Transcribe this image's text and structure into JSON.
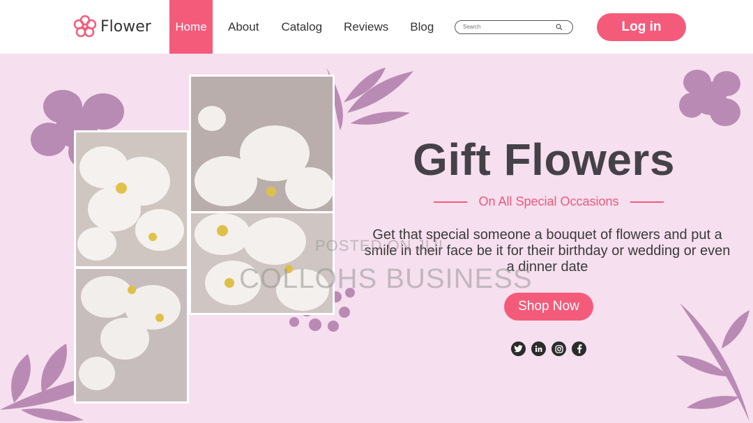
{
  "header": {
    "logo_text": "Flower",
    "nav": [
      {
        "label": "Home",
        "active": true
      },
      {
        "label": "About"
      },
      {
        "label": "Catalog"
      },
      {
        "label": "Reviews"
      },
      {
        "label": "Blog"
      }
    ],
    "search_placeholder": "Search",
    "login_label": "Log in"
  },
  "hero": {
    "title": "Gift Flowers",
    "subtitle": "On All Special Occasions",
    "description": "Get that special someone a bouquet of flowers and put a smile in their face be it for their birthday or wedding or even a dinner date",
    "shop_label": "Shop Now",
    "socials": [
      "twitter-icon",
      "linkedin-icon",
      "instagram-icon",
      "facebook-icon"
    ]
  },
  "watermark": {
    "line1": "POSTED ON JIJI",
    "line2": "COLLOHS BUSINESS"
  },
  "colors": {
    "accent": "#f45b7b",
    "background": "#f6dfee",
    "decoration": "#b98bb4",
    "title": "#454148"
  }
}
